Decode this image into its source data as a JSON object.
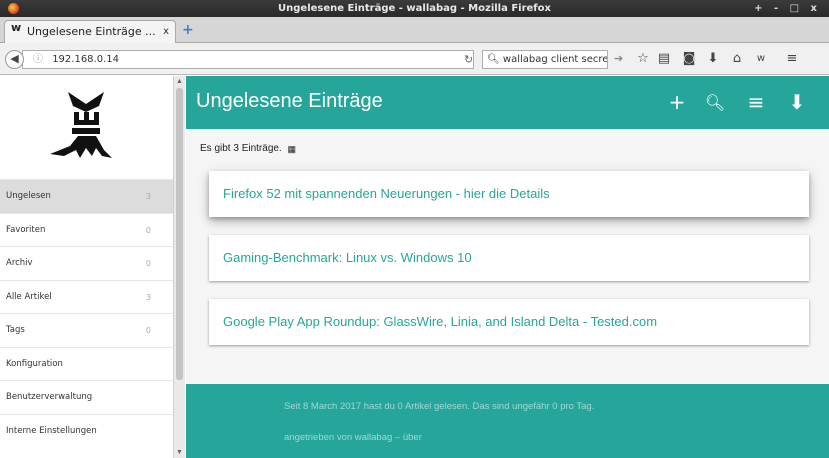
{
  "window": {
    "title": "Ungelesene Einträge - wallabag - Mozilla Firefox",
    "controls": "+ - □ x"
  },
  "tab": {
    "favicon": "w",
    "label": "Ungelesene Einträge ...",
    "close": "x",
    "new_tab": "+"
  },
  "navbar": {
    "url": "192.168.0.14",
    "search_text": "wallabag client secret",
    "icons": [
      "back-icon",
      "reload-icon",
      "search-go-icon",
      "bookmark-star-icon",
      "reader-icon",
      "pocket-icon",
      "download-icon",
      "home-icon",
      "wallabag-icon",
      "menu-icon"
    ]
  },
  "sidebar": {
    "items": [
      {
        "label": "Ungelesen",
        "count": "3",
        "active": true
      },
      {
        "label": "Favoriten",
        "count": "0"
      },
      {
        "label": "Archiv",
        "count": "0"
      },
      {
        "label": "Alle Artikel",
        "count": "3"
      },
      {
        "label": "Tags",
        "count": "0"
      },
      {
        "label": "Konfiguration"
      },
      {
        "label": "Benutzerverwaltung"
      },
      {
        "label": "Interne Einstellungen"
      }
    ]
  },
  "header": {
    "title": "Ungelesene Einträge",
    "icons": [
      "add-icon",
      "search-icon",
      "filter-icon",
      "export-icon"
    ]
  },
  "main": {
    "count_text": "Es gibt 3 Einträge.",
    "entries": [
      {
        "title": "Firefox 52 mit spannenden Neuerungen - hier die Details"
      },
      {
        "title": "Gaming-Benchmark: Linux vs. Windows 10"
      },
      {
        "title": "Google Play App Roundup: GlassWire, Linia, and Island Delta - Tested.com"
      }
    ]
  },
  "footer": {
    "stats": "Seit 8 March 2017 hast du 0 Artikel gelesen. Das sind ungefähr 0 pro Tag.",
    "powered": "angetrieben von wallabag – über"
  },
  "colors": {
    "accent": "#26a69a",
    "footer_text": "#9ed9d3"
  }
}
